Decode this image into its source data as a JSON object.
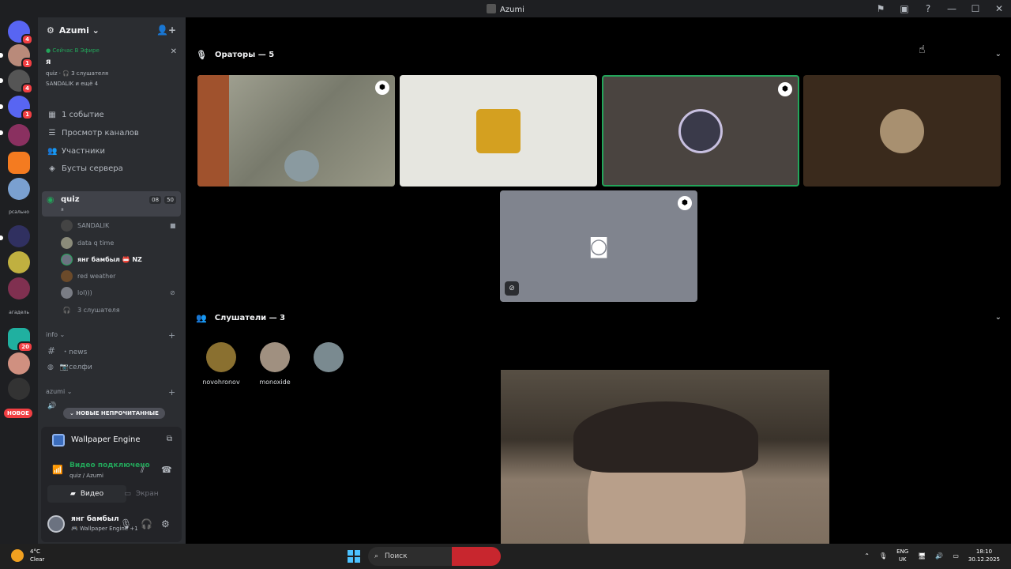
{
  "window": {
    "title": "Azumi"
  },
  "server": {
    "name": "Azumi ⌄",
    "live_label": "● Сейчас В Эфире",
    "live_user": "я",
    "live_sub1": "quiz · 🎧 3 слушателя",
    "live_sub2": "SANDALIK и ещё 4"
  },
  "rail": {
    "badges": [
      "4",
      "1",
      "4",
      "1",
      "20"
    ],
    "labels": [
      "рсально",
      "агадель"
    ],
    "new_pill": "НОВОЕ"
  },
  "menu": [
    {
      "label": "1 событие",
      "icon": "calendar-icon"
    },
    {
      "label": "Просмотр каналов",
      "icon": "browse-icon"
    },
    {
      "label": "Участники",
      "icon": "members-icon"
    },
    {
      "label": "Бусты сервера",
      "icon": "boost-icon"
    }
  ],
  "voice_channel": {
    "name": "quiz",
    "sub": "я",
    "count1": "08",
    "count2": "50"
  },
  "members": [
    {
      "name": "SANDALIK"
    },
    {
      "name": "data q time"
    },
    {
      "name": "янг бамбыл 📛 NZ"
    },
    {
      "name": "red weather"
    },
    {
      "name": "lol)))"
    },
    {
      "name": "3 слушателя"
    }
  ],
  "categories": [
    {
      "name": "info ⌄"
    },
    {
      "name": "azumi ⌄"
    }
  ],
  "channels": [
    {
      "name": "・news"
    },
    {
      "name": "📷селфи"
    }
  ],
  "unread_button": "⌄ НОВЫЕ НЕПРОЧИТАННЫЕ",
  "activity": {
    "app": "Wallpaper Engine"
  },
  "voice": {
    "status": "Видео подключено",
    "location": "quiz / Azumi",
    "video_btn": "Видео",
    "screen_btn": "Экран"
  },
  "user": {
    "name": "янг бамбыл",
    "status": "🎮 Wallpaper Engine +1"
  },
  "stage": {
    "speakers_label": "Ораторы — 5",
    "listeners_label": "Слушатели — 3",
    "listeners": [
      {
        "name": "novohronov"
      },
      {
        "name": "monoxide"
      },
      {
        "name": ""
      }
    ]
  },
  "taskbar": {
    "temp": "4°C",
    "weather": "Clear",
    "search_placeholder": "Поиск",
    "lang1": "ENG",
    "lang2": "UK",
    "time": "18:10",
    "date": "30.12.2025"
  },
  "colors": {
    "accent_green": "#23a55a",
    "badge_red": "#f23f43",
    "blurple": "#5865f2"
  }
}
